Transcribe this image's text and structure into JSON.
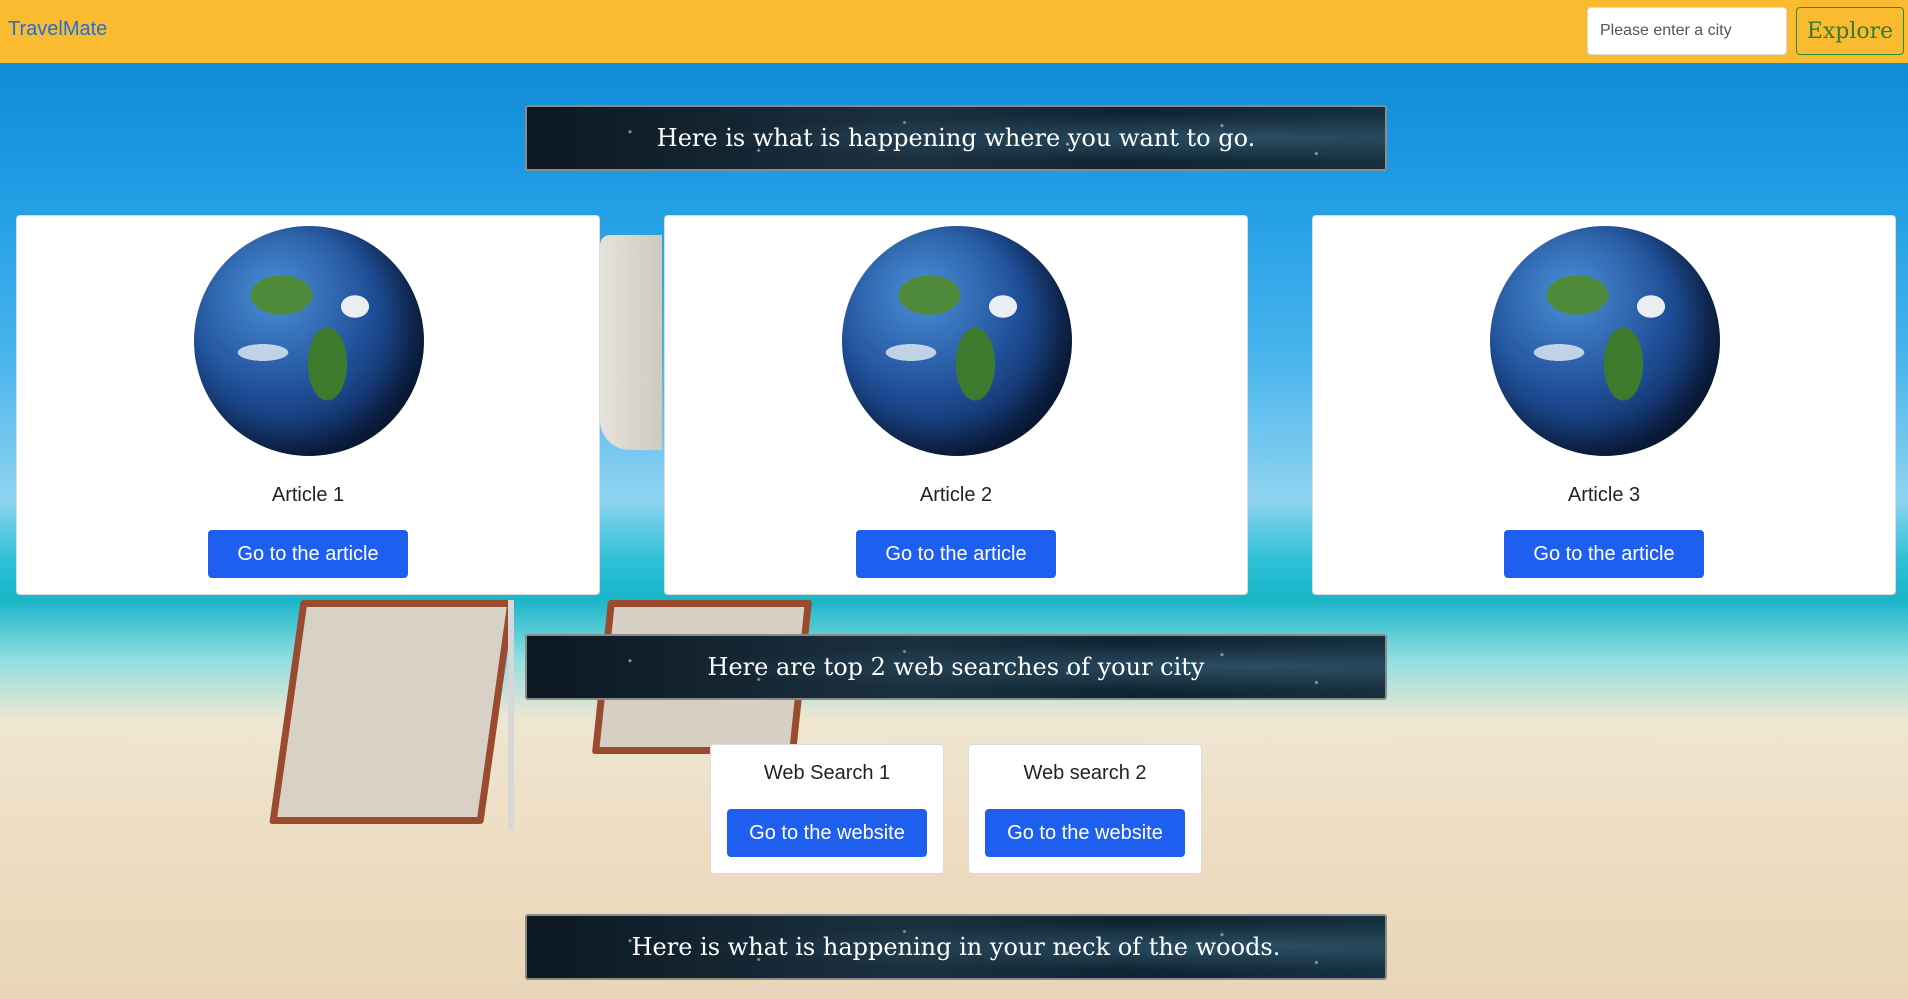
{
  "navbar": {
    "brand": "TravelMate",
    "search_placeholder": "Please enter a city",
    "explore_label": "Explore"
  },
  "banners": {
    "top": "Here is what is happening where you want to go.",
    "middle": "Here are top 2 web searches of your city",
    "bottom": "Here is what is happening in your neck of the woods."
  },
  "articles": [
    {
      "title": "Article 1",
      "button": "Go to the article"
    },
    {
      "title": "Article 2",
      "button": "Go to the article"
    },
    {
      "title": "Article 3",
      "button": "Go to the article"
    }
  ],
  "web_searches": [
    {
      "title": "Web Search 1",
      "button": "Go to the website"
    },
    {
      "title": "Web search 2",
      "button": "Go to the website"
    }
  ],
  "colors": {
    "navbar": "#fbbb31",
    "brand": "#1f6fd6",
    "primary_button": "#1f5ff0",
    "explore_border": "#2f8a3a"
  },
  "icons": [
    "globe-image"
  ]
}
